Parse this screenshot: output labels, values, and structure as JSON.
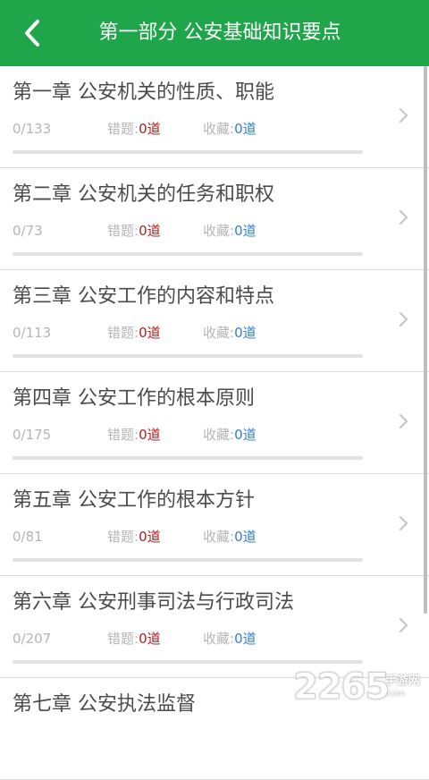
{
  "colors": {
    "accent": "#1fa64b",
    "wrong_count": "#b71c1c",
    "favorite_count": "#2f7fd8",
    "muted_text": "#b5b5b5"
  },
  "header": {
    "back_icon": "chevron-left-icon",
    "title": "第一部分 公安基础知识要点"
  },
  "labels": {
    "wrong": "错题:",
    "favorite": "收藏:"
  },
  "chapters": [
    {
      "title": "第一章 公安机关的性质、职能",
      "progress": "0/133",
      "completed": 0,
      "total": 133,
      "wrong_count": "0道",
      "favorite_count": "0道"
    },
    {
      "title": "第二章 公安机关的任务和职权",
      "progress": "0/73",
      "completed": 0,
      "total": 73,
      "wrong_count": "0道",
      "favorite_count": "0道"
    },
    {
      "title": "第三章 公安工作的内容和特点",
      "progress": "0/113",
      "completed": 0,
      "total": 113,
      "wrong_count": "0道",
      "favorite_count": "0道"
    },
    {
      "title": "第四章 公安工作的根本原则",
      "progress": "0/175",
      "completed": 0,
      "total": 175,
      "wrong_count": "0道",
      "favorite_count": "0道"
    },
    {
      "title": "第五章 公安工作的根本方针",
      "progress": "0/81",
      "completed": 0,
      "total": 81,
      "wrong_count": "0道",
      "favorite_count": "0道"
    },
    {
      "title": "第六章 公安刑事司法与行政司法",
      "progress": "0/207",
      "completed": 0,
      "total": 207,
      "wrong_count": "0道",
      "favorite_count": "0道"
    },
    {
      "title": "第七章 公安执法监督"
    }
  ],
  "watermark": {
    "number": "2265",
    "text": "手游网",
    "url": ".com"
  }
}
